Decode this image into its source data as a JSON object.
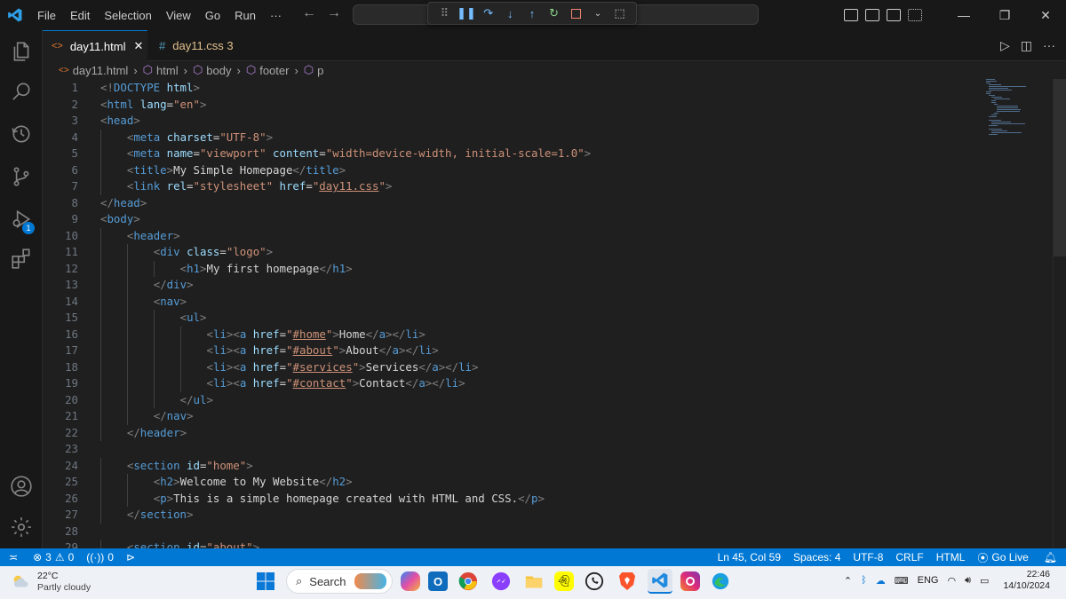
{
  "menu": [
    "File",
    "Edit",
    "Selection",
    "View",
    "Go",
    "Run",
    "···"
  ],
  "tabs": [
    {
      "label": "day11.html",
      "icon": "html-file-icon",
      "active": true
    },
    {
      "label": "day11.css 3",
      "icon": "css-file-icon",
      "active": false
    }
  ],
  "breadcrumb": [
    "day11.html",
    "html",
    "body",
    "footer",
    "p"
  ],
  "code_lines": [
    {
      "n": "1",
      "indent": 0,
      "parts": [
        [
          "pc",
          "<!"
        ],
        [
          "tg",
          "DOCTYPE"
        ],
        [
          "tx",
          " "
        ],
        [
          "at",
          "html"
        ],
        [
          "pc",
          ">"
        ]
      ]
    },
    {
      "n": "2",
      "indent": 0,
      "parts": [
        [
          "pc",
          "<"
        ],
        [
          "tg",
          "html"
        ],
        [
          "tx",
          " "
        ],
        [
          "at",
          "lang"
        ],
        [
          "tx",
          "="
        ],
        [
          "st",
          "\"en\""
        ],
        [
          "pc",
          ">"
        ]
      ]
    },
    {
      "n": "3",
      "indent": 0,
      "parts": [
        [
          "pc",
          "<"
        ],
        [
          "tg",
          "head"
        ],
        [
          "pc",
          ">"
        ]
      ]
    },
    {
      "n": "4",
      "indent": 1,
      "parts": [
        [
          "pc",
          "<"
        ],
        [
          "tg",
          "meta"
        ],
        [
          "tx",
          " "
        ],
        [
          "at",
          "charset"
        ],
        [
          "tx",
          "="
        ],
        [
          "st",
          "\"UTF-8\""
        ],
        [
          "pc",
          ">"
        ]
      ]
    },
    {
      "n": "5",
      "indent": 1,
      "parts": [
        [
          "pc",
          "<"
        ],
        [
          "tg",
          "meta"
        ],
        [
          "tx",
          " "
        ],
        [
          "at",
          "name"
        ],
        [
          "tx",
          "="
        ],
        [
          "st",
          "\"viewport\""
        ],
        [
          "tx",
          " "
        ],
        [
          "at",
          "content"
        ],
        [
          "tx",
          "="
        ],
        [
          "st",
          "\"width=device-width, initial-scale=1.0\""
        ],
        [
          "pc",
          ">"
        ]
      ]
    },
    {
      "n": "6",
      "indent": 1,
      "parts": [
        [
          "pc",
          "<"
        ],
        [
          "tg",
          "title"
        ],
        [
          "pc",
          ">"
        ],
        [
          "tx",
          "My Simple Homepage"
        ],
        [
          "pc",
          "</"
        ],
        [
          "tg",
          "title"
        ],
        [
          "pc",
          ">"
        ]
      ]
    },
    {
      "n": "7",
      "indent": 1,
      "parts": [
        [
          "pc",
          "<"
        ],
        [
          "tg",
          "link"
        ],
        [
          "tx",
          " "
        ],
        [
          "at",
          "rel"
        ],
        [
          "tx",
          "="
        ],
        [
          "st",
          "\"stylesheet\""
        ],
        [
          "tx",
          " "
        ],
        [
          "at",
          "href"
        ],
        [
          "tx",
          "="
        ],
        [
          "st",
          "\""
        ],
        [
          "stu",
          "day11.css"
        ],
        [
          "st",
          "\""
        ],
        [
          "pc",
          ">"
        ]
      ]
    },
    {
      "n": "8",
      "indent": 0,
      "parts": [
        [
          "pc",
          "</"
        ],
        [
          "tg",
          "head"
        ],
        [
          "pc",
          ">"
        ]
      ]
    },
    {
      "n": "9",
      "indent": 0,
      "parts": [
        [
          "pc",
          "<"
        ],
        [
          "tg",
          "body"
        ],
        [
          "pc",
          ">"
        ]
      ]
    },
    {
      "n": "10",
      "indent": 1,
      "parts": [
        [
          "pc",
          "<"
        ],
        [
          "tg",
          "header"
        ],
        [
          "pc",
          ">"
        ]
      ]
    },
    {
      "n": "11",
      "indent": 2,
      "parts": [
        [
          "pc",
          "<"
        ],
        [
          "tg",
          "div"
        ],
        [
          "tx",
          " "
        ],
        [
          "at",
          "class"
        ],
        [
          "tx",
          "="
        ],
        [
          "st",
          "\"logo\""
        ],
        [
          "pc",
          ">"
        ]
      ]
    },
    {
      "n": "12",
      "indent": 3,
      "parts": [
        [
          "pc",
          "<"
        ],
        [
          "tg",
          "h1"
        ],
        [
          "pc",
          ">"
        ],
        [
          "tx",
          "My first homepage"
        ],
        [
          "pc",
          "</"
        ],
        [
          "tg",
          "h1"
        ],
        [
          "pc",
          ">"
        ]
      ]
    },
    {
      "n": "13",
      "indent": 2,
      "parts": [
        [
          "pc",
          "</"
        ],
        [
          "tg",
          "div"
        ],
        [
          "pc",
          ">"
        ]
      ]
    },
    {
      "n": "14",
      "indent": 2,
      "parts": [
        [
          "pc",
          "<"
        ],
        [
          "tg",
          "nav"
        ],
        [
          "pc",
          ">"
        ]
      ]
    },
    {
      "n": "15",
      "indent": 3,
      "parts": [
        [
          "pc",
          "<"
        ],
        [
          "tg",
          "ul"
        ],
        [
          "pc",
          ">"
        ]
      ]
    },
    {
      "n": "16",
      "indent": 4,
      "parts": [
        [
          "pc",
          "<"
        ],
        [
          "tg",
          "li"
        ],
        [
          "pc",
          "><"
        ],
        [
          "tg",
          "a"
        ],
        [
          "tx",
          " "
        ],
        [
          "at",
          "href"
        ],
        [
          "tx",
          "="
        ],
        [
          "st",
          "\""
        ],
        [
          "stu",
          "#home"
        ],
        [
          "st",
          "\""
        ],
        [
          "pc",
          ">"
        ],
        [
          "tx",
          "Home"
        ],
        [
          "pc",
          "</"
        ],
        [
          "tg",
          "a"
        ],
        [
          "pc",
          "></"
        ],
        [
          "tg",
          "li"
        ],
        [
          "pc",
          ">"
        ]
      ]
    },
    {
      "n": "17",
      "indent": 4,
      "parts": [
        [
          "pc",
          "<"
        ],
        [
          "tg",
          "li"
        ],
        [
          "pc",
          "><"
        ],
        [
          "tg",
          "a"
        ],
        [
          "tx",
          " "
        ],
        [
          "at",
          "href"
        ],
        [
          "tx",
          "="
        ],
        [
          "st",
          "\""
        ],
        [
          "stu",
          "#about"
        ],
        [
          "st",
          "\""
        ],
        [
          "pc",
          ">"
        ],
        [
          "tx",
          "About"
        ],
        [
          "pc",
          "</"
        ],
        [
          "tg",
          "a"
        ],
        [
          "pc",
          "></"
        ],
        [
          "tg",
          "li"
        ],
        [
          "pc",
          ">"
        ]
      ]
    },
    {
      "n": "18",
      "indent": 4,
      "parts": [
        [
          "pc",
          "<"
        ],
        [
          "tg",
          "li"
        ],
        [
          "pc",
          "><"
        ],
        [
          "tg",
          "a"
        ],
        [
          "tx",
          " "
        ],
        [
          "at",
          "href"
        ],
        [
          "tx",
          "="
        ],
        [
          "st",
          "\""
        ],
        [
          "stu",
          "#services"
        ],
        [
          "st",
          "\""
        ],
        [
          "pc",
          ">"
        ],
        [
          "tx",
          "Services"
        ],
        [
          "pc",
          "</"
        ],
        [
          "tg",
          "a"
        ],
        [
          "pc",
          "></"
        ],
        [
          "tg",
          "li"
        ],
        [
          "pc",
          ">"
        ]
      ]
    },
    {
      "n": "19",
      "indent": 4,
      "parts": [
        [
          "pc",
          "<"
        ],
        [
          "tg",
          "li"
        ],
        [
          "pc",
          "><"
        ],
        [
          "tg",
          "a"
        ],
        [
          "tx",
          " "
        ],
        [
          "at",
          "href"
        ],
        [
          "tx",
          "="
        ],
        [
          "st",
          "\""
        ],
        [
          "stu",
          "#contact"
        ],
        [
          "st",
          "\""
        ],
        [
          "pc",
          ">"
        ],
        [
          "tx",
          "Contact"
        ],
        [
          "pc",
          "</"
        ],
        [
          "tg",
          "a"
        ],
        [
          "pc",
          "></"
        ],
        [
          "tg",
          "li"
        ],
        [
          "pc",
          ">"
        ]
      ]
    },
    {
      "n": "20",
      "indent": 3,
      "parts": [
        [
          "pc",
          "</"
        ],
        [
          "tg",
          "ul"
        ],
        [
          "pc",
          ">"
        ]
      ]
    },
    {
      "n": "21",
      "indent": 2,
      "parts": [
        [
          "pc",
          "</"
        ],
        [
          "tg",
          "nav"
        ],
        [
          "pc",
          ">"
        ]
      ]
    },
    {
      "n": "22",
      "indent": 1,
      "parts": [
        [
          "pc",
          "</"
        ],
        [
          "tg",
          "header"
        ],
        [
          "pc",
          ">"
        ]
      ]
    },
    {
      "n": "23",
      "indent": 0,
      "parts": []
    },
    {
      "n": "24",
      "indent": 1,
      "parts": [
        [
          "pc",
          "<"
        ],
        [
          "tg",
          "section"
        ],
        [
          "tx",
          " "
        ],
        [
          "at",
          "id"
        ],
        [
          "tx",
          "="
        ],
        [
          "st",
          "\"home\""
        ],
        [
          "pc",
          ">"
        ]
      ]
    },
    {
      "n": "25",
      "indent": 2,
      "parts": [
        [
          "pc",
          "<"
        ],
        [
          "tg",
          "h2"
        ],
        [
          "pc",
          ">"
        ],
        [
          "tx",
          "Welcome to My Website"
        ],
        [
          "pc",
          "</"
        ],
        [
          "tg",
          "h2"
        ],
        [
          "pc",
          ">"
        ]
      ]
    },
    {
      "n": "26",
      "indent": 2,
      "parts": [
        [
          "pc",
          "<"
        ],
        [
          "tg",
          "p"
        ],
        [
          "pc",
          ">"
        ],
        [
          "tx",
          "This is a simple homepage created with HTML and CSS."
        ],
        [
          "pc",
          "</"
        ],
        [
          "tg",
          "p"
        ],
        [
          "pc",
          ">"
        ]
      ]
    },
    {
      "n": "27",
      "indent": 1,
      "parts": [
        [
          "pc",
          "</"
        ],
        [
          "tg",
          "section"
        ],
        [
          "pc",
          ">"
        ]
      ]
    },
    {
      "n": "28",
      "indent": 0,
      "parts": []
    },
    {
      "n": "29",
      "indent": 1,
      "parts": [
        [
          "pc",
          "<"
        ],
        [
          "tg",
          "section"
        ],
        [
          "tx",
          " "
        ],
        [
          "at",
          "id"
        ],
        [
          "tx",
          "="
        ],
        [
          "st",
          "\"about\""
        ],
        [
          "pc",
          ">"
        ]
      ]
    }
  ],
  "statusbar": {
    "errors": "3",
    "warnings": "0",
    "ports": "0",
    "position": "Ln 45, Col 59",
    "spaces": "Spaces: 4",
    "encoding": "UTF-8",
    "eol": "CRLF",
    "language": "HTML",
    "golive": "Go Live"
  },
  "taskbar": {
    "temperature": "22°C",
    "weather": "Partly cloudy",
    "search_label": "Search",
    "language": "ENG",
    "time": "22:46",
    "date": "14/10/2024"
  },
  "colors": {
    "accent": "#0078d4",
    "tag": "#569cd6",
    "attr": "#9cdcfe",
    "string": "#ce9178"
  }
}
